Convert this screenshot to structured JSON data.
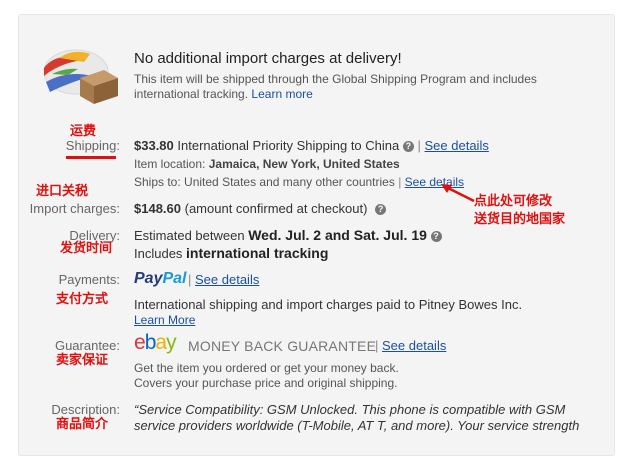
{
  "header": {
    "title": "No additional import charges at delivery!",
    "desc_line1": "This item will be shipped through the Global Shipping Program and includes",
    "desc_line2": "international tracking.",
    "learn_more": "Learn more"
  },
  "shipping": {
    "annotation": "运费",
    "label": "Shipping:",
    "price": "$33.80",
    "service": "International Priority Shipping to China",
    "see_details": "See details",
    "location_label": "Item location:",
    "location_value": "Jamaica, New York, United States",
    "ships_to_label": "Ships to:",
    "ships_to_value": "United States and many other countries",
    "ships_to_see_details": "See details",
    "callout_line1": "点此处可修改",
    "callout_line2": "送货目的地国家"
  },
  "import": {
    "annotation": "进口关税",
    "label": "Import charges:",
    "price": "$148.60",
    "note": "(amount confirmed at checkout)"
  },
  "delivery": {
    "label": "Delivery:",
    "annotation": "发货时间",
    "prefix": "Estimated between",
    "range": "Wed. Jul. 2 and Sat. Jul. 19",
    "includes": "Includes",
    "tracking": "international tracking"
  },
  "payments": {
    "label": "Payments:",
    "annotation": "支付方式",
    "logo_pay": "Pay",
    "logo_pal": "Pal",
    "see_details": "See details",
    "note": "International shipping and import charges paid to Pitney Bowes Inc.",
    "learn_more": "Learn More"
  },
  "guarantee": {
    "label": "Guarantee:",
    "annotation": "卖家保证",
    "logo_e": "e",
    "logo_b": "b",
    "logo_a": "a",
    "logo_y": "y",
    "money_back": "MONEY BACK GUARANTEE",
    "see_details": "See details",
    "line1": "Get the item you ordered or get your money back.",
    "line2": "Covers your purchase price and original shipping."
  },
  "description": {
    "label": "Description:",
    "annotation": "商品简介",
    "line1": "“Service Compatibility: GSM Unlocked. This phone is compatible with GSM",
    "line2": "service providers worldwide (T-Mobile, AT T, and more). Your service strength"
  },
  "colors": {
    "link": "#1a4fa3",
    "annotation_red": "#e01010",
    "paypal_dark": "#253b80",
    "paypal_light": "#179bd7"
  }
}
